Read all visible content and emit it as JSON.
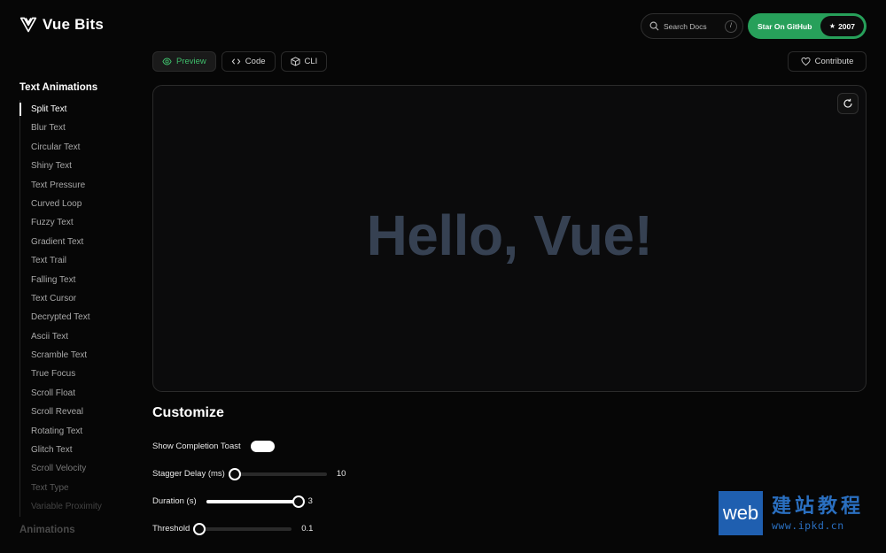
{
  "header": {
    "brand": "Vue Bits",
    "search_placeholder": "Search Docs",
    "search_shortcut": "/",
    "github_label": "Star On GitHub",
    "github_stars": "2007"
  },
  "sidebar": {
    "section_title": "Text Animations",
    "items": [
      "Split Text",
      "Blur Text",
      "Circular Text",
      "Shiny Text",
      "Text Pressure",
      "Curved Loop",
      "Fuzzy Text",
      "Gradient Text",
      "Text Trail",
      "Falling Text",
      "Text Cursor",
      "Decrypted Text",
      "Ascii Text",
      "Scramble Text",
      "True Focus",
      "Scroll Float",
      "Scroll Reveal",
      "Rotating Text",
      "Glitch Text",
      "Scroll Velocity",
      "Text Type",
      "Variable Proximity"
    ],
    "active_item": "Split Text",
    "next_section_title": "Animations"
  },
  "tabs": [
    {
      "label": "Preview",
      "icon": "eye-icon",
      "active": true
    },
    {
      "label": "Code",
      "icon": "code-icon",
      "active": false
    },
    {
      "label": "CLI",
      "icon": "box-icon",
      "active": false
    }
  ],
  "contribute_label": "Contribute",
  "preview": {
    "text": "Hello, Vue!",
    "text_color": "#364152"
  },
  "customize": {
    "title": "Customize",
    "toggle_label": "Show Completion Toast",
    "toggle_on": true,
    "sliders": [
      {
        "label": "Stagger Delay (ms)",
        "value": "10",
        "fraction": 0.0
      },
      {
        "label": "Duration (s)",
        "value": "3",
        "fraction": 1.0
      },
      {
        "label": "Threshold",
        "value": "0.1",
        "fraction": 0.0
      }
    ]
  },
  "watermark": {
    "badge": "web",
    "title": "建站教程",
    "url": "www.ipkd.cn"
  },
  "colors": {
    "accent": "#27a05a",
    "background": "#060606"
  }
}
